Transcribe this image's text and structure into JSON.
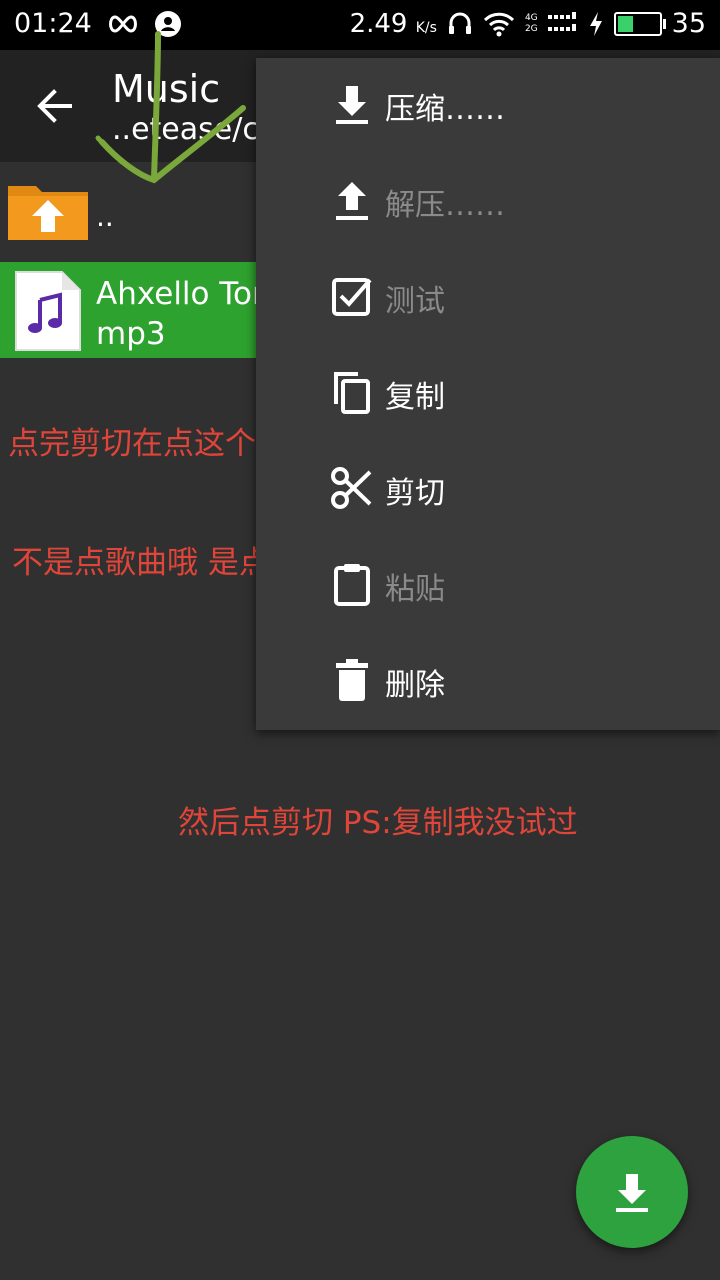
{
  "status_bar": {
    "time": "01:24",
    "speed": "2.49",
    "speed_unit": "K/s",
    "battery": "35",
    "network_top": "4G",
    "network_bottom": "2G",
    "icons": [
      "infinity-icon",
      "user-icon",
      "headset-icon",
      "wifi-icon",
      "signal-icon",
      "charging-icon",
      "battery-icon"
    ]
  },
  "appbar": {
    "title": "Music",
    "subtitle": "..etease/cl"
  },
  "file_list": {
    "up_label": "..",
    "items": [
      {
        "name_line1": "Ahxello Tor",
        "name_line2": "mp3"
      }
    ]
  },
  "menu": {
    "items": [
      {
        "label": "压缩……",
        "enabled": true
      },
      {
        "label": "解压……",
        "enabled": false
      },
      {
        "label": "测试",
        "enabled": false
      },
      {
        "label": "复制",
        "enabled": true
      },
      {
        "label": "剪切",
        "enabled": true
      },
      {
        "label": "粘贴",
        "enabled": false
      },
      {
        "label": "删除",
        "enabled": true
      }
    ]
  },
  "annotations": {
    "note1": "点完剪切在点这个",
    "note2": "不是点歌曲哦 是点歌曲上面的那个~",
    "note3": "然后点剪切 PS:复制我没试过"
  },
  "colors": {
    "background": "#303030",
    "appbar": "#222222",
    "menu": "#3a3a3a",
    "selected_row": "#2ea22e",
    "fab": "#2ea23e",
    "annotation_text": "#e0453a",
    "annotation_arrow": "#7aa83a",
    "folder": "#f39a1e"
  },
  "fab": {
    "icon": "download-icon"
  }
}
